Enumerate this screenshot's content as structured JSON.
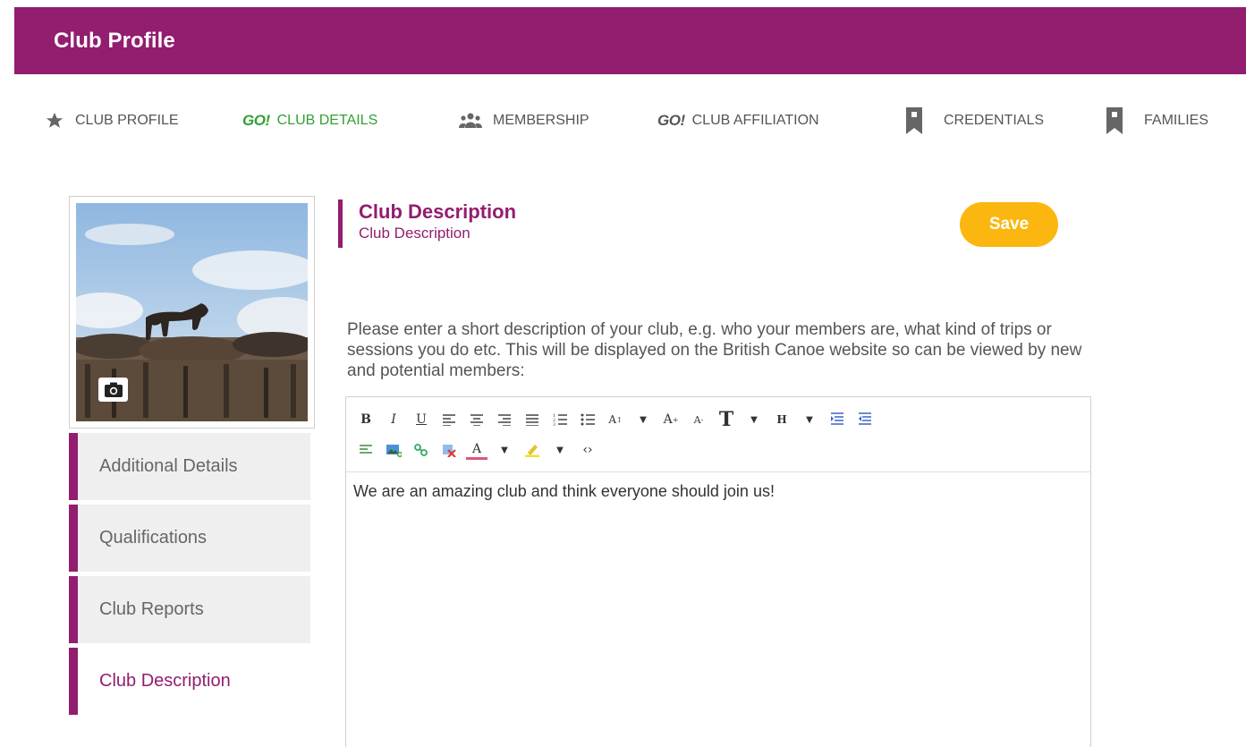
{
  "colors": {
    "brand": "#931d6f",
    "accent": "#fbb70f",
    "active_tab": "#33a033"
  },
  "header": {
    "title": "Club Profile"
  },
  "tabs": [
    {
      "label": "CLUB PROFILE",
      "icon": "star-icon"
    },
    {
      "label": "CLUB DETAILS",
      "icon": "go-logo-icon",
      "logo_text": "GO!",
      "active": true
    },
    {
      "label": "MEMBERSHIP",
      "icon": "people-icon"
    },
    {
      "label": "CLUB AFFILIATION",
      "icon": "go-logo-icon",
      "logo_text": "GO!"
    },
    {
      "label": "CREDENTIALS",
      "icon": "bookmark-icon"
    },
    {
      "label": "FAMILIES",
      "icon": "bookmark-icon"
    }
  ],
  "photo": {
    "alt": "club photo",
    "camera_icon": "camera-icon"
  },
  "sidebar": {
    "items": [
      {
        "label": "Additional Details"
      },
      {
        "label": "Qualifications"
      },
      {
        "label": "Club Reports"
      },
      {
        "label": "Club Description",
        "active": true
      }
    ]
  },
  "section": {
    "title": "Club Description",
    "subtitle": "Club Description"
  },
  "save_label": "Save",
  "instructions": "Please enter a short description of your club, e.g. who your members are, what kind of trips or sessions you do etc. This will be displayed on the British Canoe website so can be viewed by new and potential members:",
  "editor": {
    "toolbar_row1": [
      "bold",
      "italic",
      "underline",
      "align-left",
      "align-center",
      "align-right",
      "align-justify",
      "ordered-list",
      "unordered-list",
      "font-size",
      "font-size-dropdown",
      "increase-font",
      "decrease-font",
      "font-family",
      "font-family-dropdown",
      "heading",
      "heading-dropdown",
      "indent",
      "outdent"
    ],
    "toolbar_row2": [
      "paragraph",
      "insert-image",
      "insert-link",
      "remove-link",
      "font-color",
      "font-color-dropdown",
      "highlight",
      "highlight-dropdown",
      "source-code"
    ],
    "content": "We are an amazing club and think everyone should join us!"
  }
}
